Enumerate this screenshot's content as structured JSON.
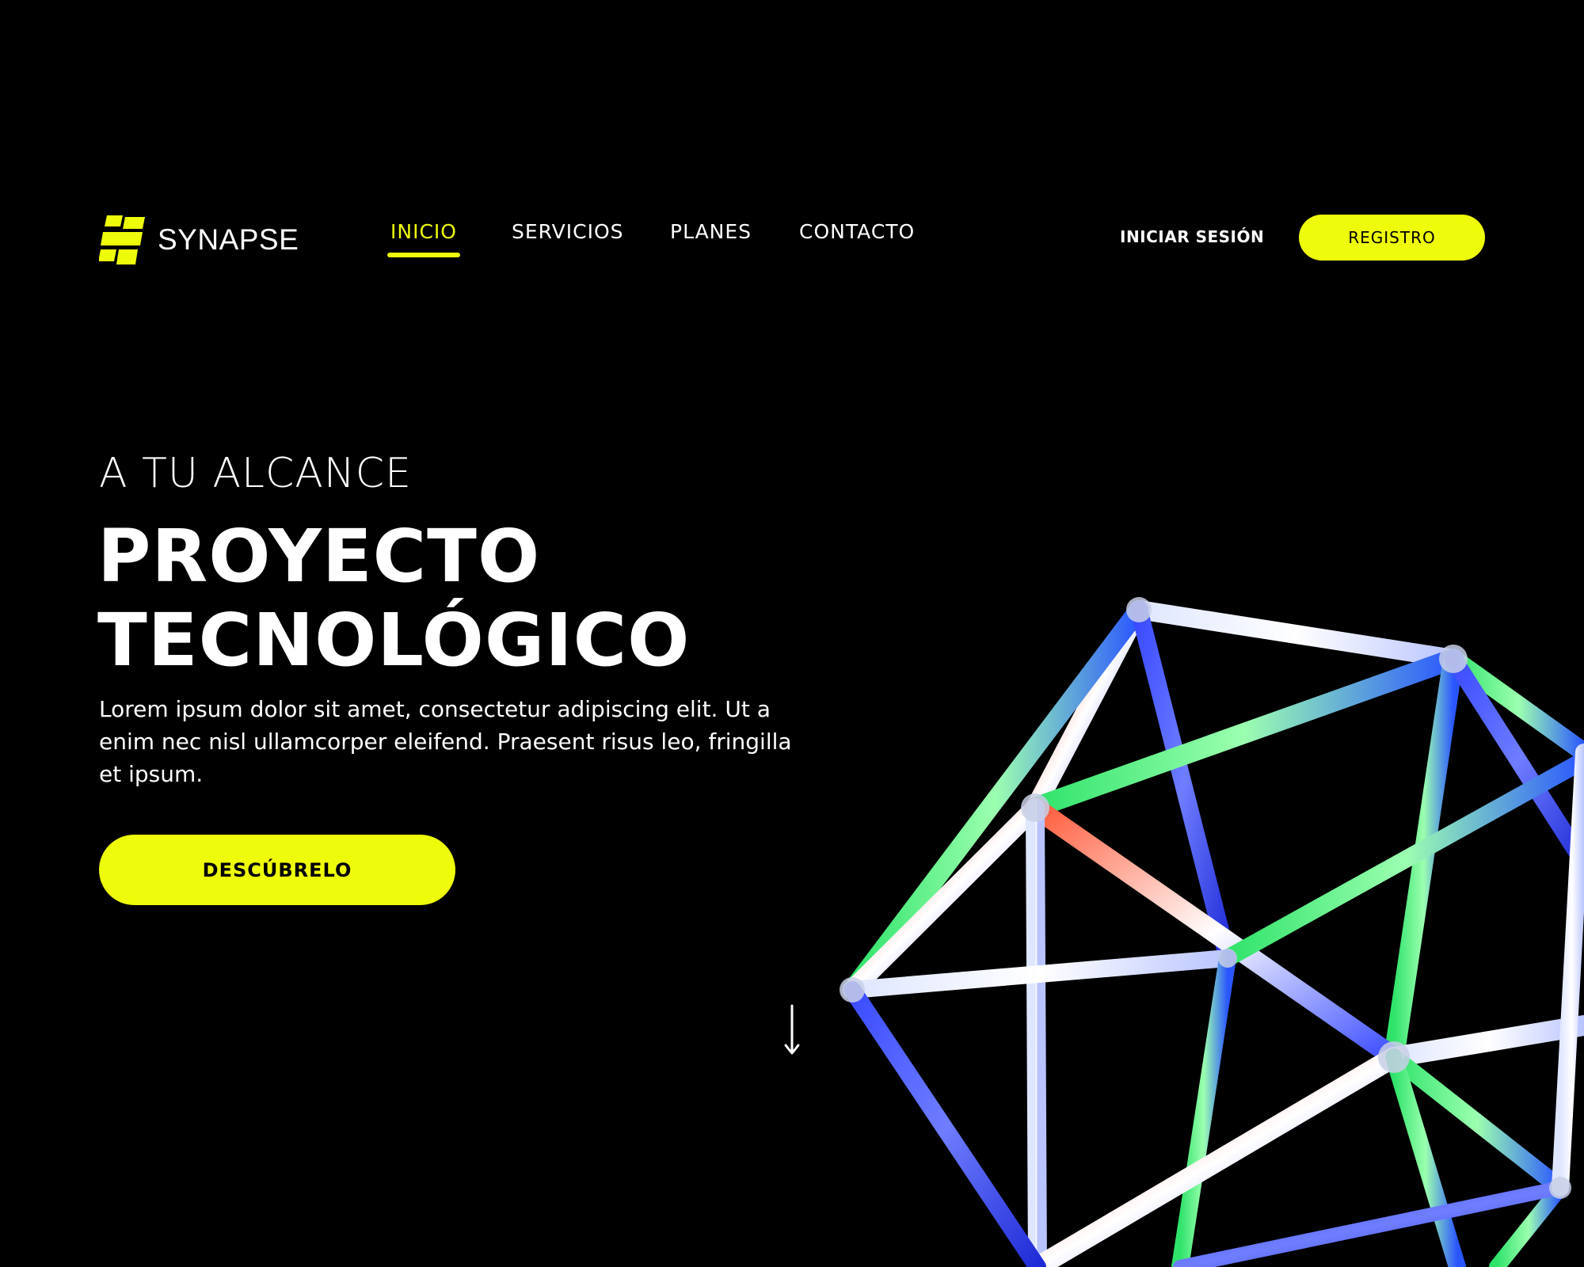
{
  "brand": {
    "name": "SYNAPSE",
    "logo_icon": "stacked-parallelogram-logo",
    "accent_color": "#EEFC0B"
  },
  "nav": {
    "items": [
      {
        "label": "INICIO",
        "active": true
      },
      {
        "label": "SERVICIOS",
        "active": false
      },
      {
        "label": "PLANES",
        "active": false
      },
      {
        "label": "CONTACTO",
        "active": false
      }
    ]
  },
  "auth": {
    "login_label": "INICIAR SESIÓN",
    "register_label": "REGISTRO"
  },
  "hero": {
    "eyebrow": "A TU ALCANCE",
    "title_line1": "PROYECTO",
    "title_line2": "TECNOLÓGICO",
    "description": "Lorem ipsum dolor sit amet, consectetur adipiscing elit. Ut a enim nec nisl ullamcorper eleifend. Praesent risus leo, fringilla et ipsum.",
    "cta_label": "DESCÚBRELO",
    "scroll_icon": "arrow-down-icon",
    "image": "iridescent-icosahedron-wireframe"
  },
  "colors": {
    "background": "#000000",
    "text": "#FFFFFF",
    "accent": "#EEFC0B"
  }
}
